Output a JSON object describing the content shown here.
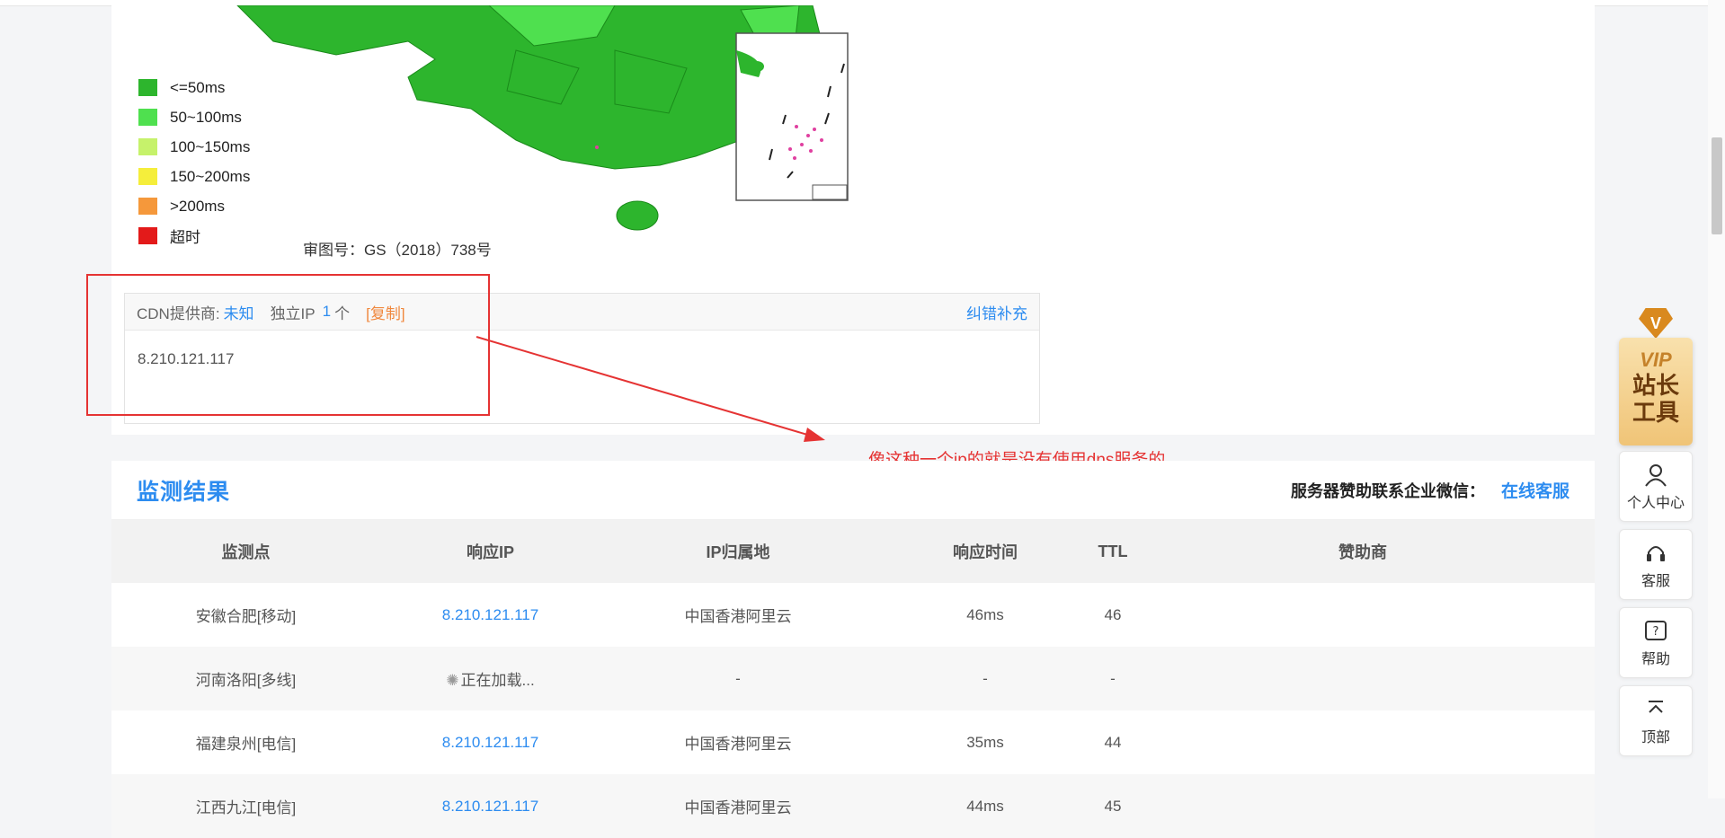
{
  "legend": [
    {
      "label": "<=50ms",
      "color": "#2db52d"
    },
    {
      "label": "50~100ms",
      "color": "#4fe04f"
    },
    {
      "label": "100~150ms",
      "color": "#c6f26b"
    },
    {
      "label": "150~200ms",
      "color": "#f5ee3b"
    },
    {
      "label": ">200ms",
      "color": "#f5983b"
    },
    {
      "label": "超时",
      "color": "#e31a1a"
    }
  ],
  "map": {
    "approval": "审图号：GS（2018）738号"
  },
  "cdn": {
    "provider_label": "CDN提供商:",
    "provider_value": "未知",
    "unique_ip_label": "独立IP",
    "unique_ip_count": "1",
    "unique_ip_unit": "个",
    "copy_label": "[复制]",
    "correction_label": "纠错补充",
    "ip": "8.210.121.117"
  },
  "annotation": {
    "text": "像这种一个ip的就是没有使用dns服务的"
  },
  "monitor": {
    "title": "监测结果",
    "sponsor_text": "服务器赞助联系企业微信：",
    "sponsor_link": "在线客服",
    "columns": [
      "监测点",
      "响应IP",
      "IP归属地",
      "响应时间",
      "TTL",
      "赞助商"
    ],
    "rows": [
      {
        "point": "安徽合肥[移动]",
        "ip": "8.210.121.117",
        "location": "中国香港阿里云",
        "time": "46ms",
        "ttl": "46",
        "sponsor": ""
      },
      {
        "point": "河南洛阳[多线]",
        "ip": "正在加载...",
        "location": "-",
        "time": "-",
        "ttl": "-",
        "sponsor": ""
      },
      {
        "point": "福建泉州[电信]",
        "ip": "8.210.121.117",
        "location": "中国香港阿里云",
        "time": "35ms",
        "ttl": "44",
        "sponsor": ""
      },
      {
        "point": "江西九江[电信]",
        "ip": "8.210.121.117",
        "location": "中国香港阿里云",
        "time": "44ms",
        "ttl": "45",
        "sponsor": ""
      }
    ]
  },
  "sidebar": {
    "vip_badge": "V",
    "vip_line1": "VIP",
    "vip_line2": "站长",
    "vip_line3": "工具",
    "items": [
      {
        "label": "个人中心",
        "icon": "user-icon"
      },
      {
        "label": "客服",
        "icon": "headset-icon"
      },
      {
        "label": "帮助",
        "icon": "help-icon"
      },
      {
        "label": "顶部",
        "icon": "back-to-top-icon"
      }
    ]
  }
}
